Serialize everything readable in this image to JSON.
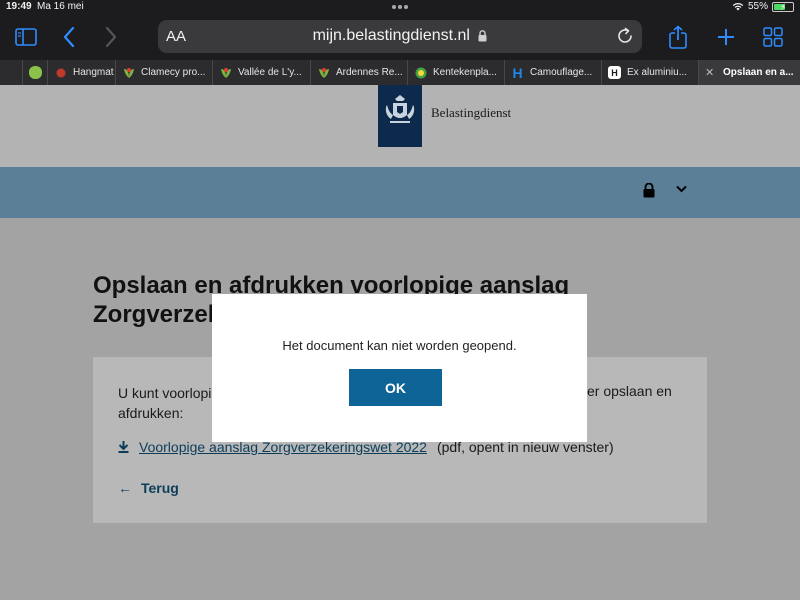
{
  "status_bar": {
    "time": "19:49",
    "date": "Ma 16 mei",
    "battery": "55%"
  },
  "browser": {
    "text_size_label": "AA",
    "url": "mijn.belastingdienst.nl",
    "tabs": [
      {
        "label": "",
        "icon": "partial-tab"
      },
      {
        "label": "",
        "icon": "chat-icon",
        "color": "#8bc34a"
      },
      {
        "label": "Hangmat",
        "icon": "flag-icon",
        "color": "#c0392b"
      },
      {
        "label": "Clamecy pro...",
        "icon": "leaf-icon",
        "color": "#7cb342"
      },
      {
        "label": "Vallée de L'y...",
        "icon": "leaf-icon",
        "color": "#7cb342"
      },
      {
        "label": "Ardennes Re...",
        "icon": "leaf-icon",
        "color": "#7cb342"
      },
      {
        "label": "Kentekenpla...",
        "icon": "car-icon",
        "color": "#43a047"
      },
      {
        "label": "Camouflage...",
        "icon": "H",
        "color": "#1e88e5"
      },
      {
        "label": "Ex aluminiu...",
        "icon": "H",
        "color": "#1c1c1e"
      },
      {
        "label": "Opslaan en a...",
        "icon": "close-icon",
        "active": true
      }
    ]
  },
  "site": {
    "name": "Belastingdienst",
    "page_title_line1": "Opslaan en afdrukken voorlopige aanslag",
    "page_title_line2": "Zorgverzek",
    "intro_start": "U kunt voorlopig",
    "intro_end": "er opslaan en",
    "intro_line2": "afdrukken:",
    "download_link": "Voorlopige aanslag Zorgverzekeringswet 2022",
    "download_note": "(pdf, opent in nieuw venster)",
    "back_label": "Terug"
  },
  "dialog": {
    "message": "Het document kan niet worden geopend.",
    "ok_label": "OK"
  },
  "colors": {
    "nav_band": "#5a7f96",
    "ok_button": "#0e6496",
    "logo": "#0d2a4c"
  }
}
